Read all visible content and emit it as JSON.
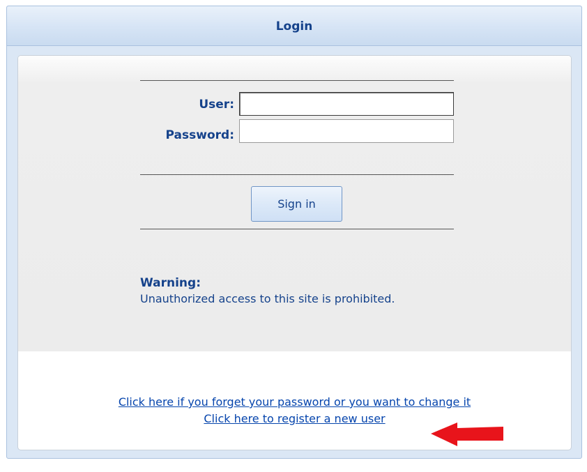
{
  "panel": {
    "title": "Login"
  },
  "form": {
    "user_label": "User:",
    "user_value": "",
    "password_label": "Password:",
    "password_value": "",
    "sign_in_label": "Sign in"
  },
  "warning": {
    "title": "Warning:",
    "text": "Unauthorized access to this site is prohibited."
  },
  "links": {
    "forgot_password": "Click here if you forget your password or you want to change it",
    "register": "Click here to register a new user"
  },
  "annotation": {
    "icon": "red-arrow-left-icon",
    "color": "#e8141b"
  },
  "colors": {
    "title_text": "#15428b",
    "link": "#0645ad",
    "header_bg": "#d6e4f5",
    "body_bg": "#ececec"
  }
}
